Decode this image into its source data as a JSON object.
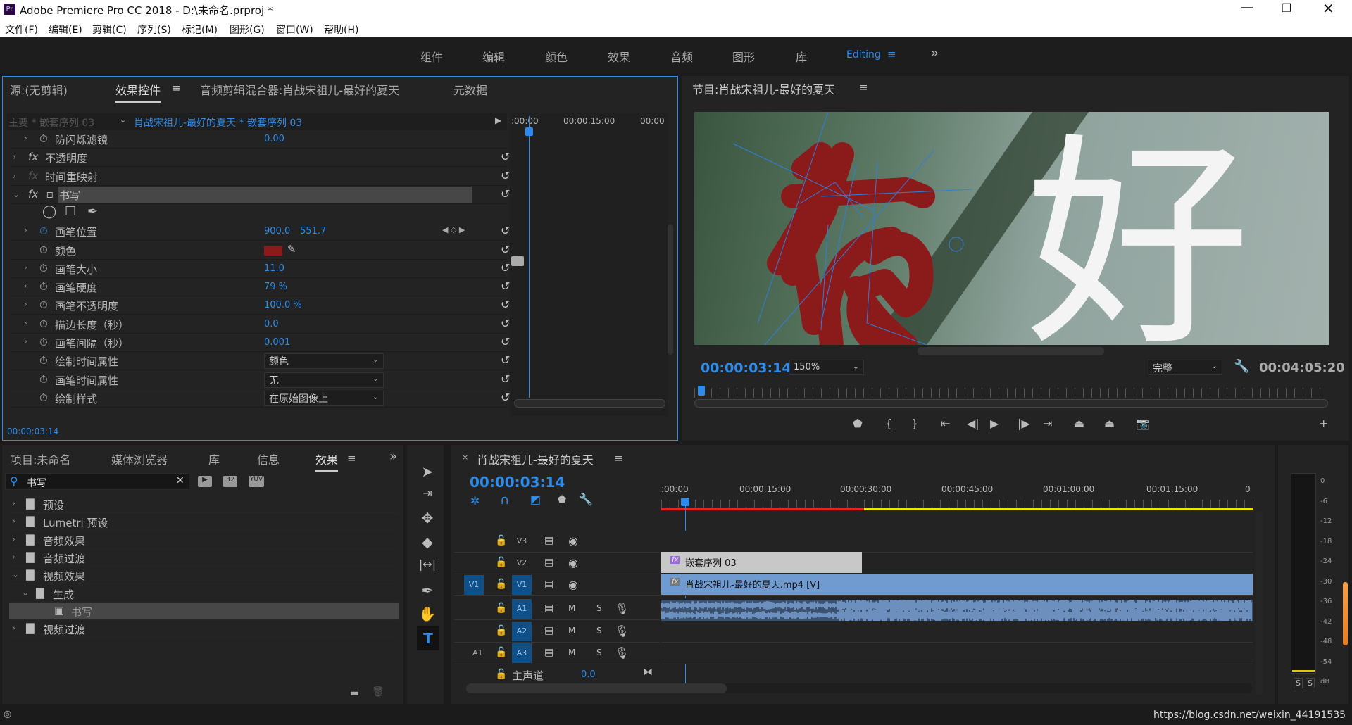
{
  "app": {
    "title": "Adobe Premiere Pro CC 2018 - D:\\未命名.prproj *",
    "logo": "Pr"
  },
  "menu": [
    "文件(F)",
    "编辑(E)",
    "剪辑(C)",
    "序列(S)",
    "标记(M)",
    "图形(G)",
    "窗口(W)",
    "帮助(H)"
  ],
  "workspaces": [
    "组件",
    "编辑",
    "颜色",
    "效果",
    "音频",
    "图形",
    "库",
    "Editing"
  ],
  "workspace_active": "Editing",
  "source_panel": {
    "tabs": [
      "源:(无剪辑)",
      "效果控件",
      "音频剪辑混合器:肖战宋祖儿-最好的夏天",
      "元数据"
    ],
    "active_tab": "效果控件",
    "master": "主要 * 嵌套序列 03",
    "clip": "肖战宋祖儿-最好的夏天 * 嵌套序列 03",
    "ruler": [
      ":00:00",
      "00:00:15:00",
      "00:00"
    ],
    "rows": [
      {
        "label": "防闪烁滤镜",
        "value": "0.00"
      },
      {
        "label": "不透明度",
        "fx": true
      },
      {
        "label": "时间重映射",
        "fx": true
      },
      {
        "label": "书写",
        "fx": true,
        "selected": true
      },
      {
        "label": "画笔位置",
        "value": "900.0",
        "value2": "551.7"
      },
      {
        "label": "颜色",
        "color": "#8b1a1a"
      },
      {
        "label": "画笔大小",
        "value": "11.0"
      },
      {
        "label": "画笔硬度",
        "value": "79 %"
      },
      {
        "label": "画笔不透明度",
        "value": "100.0 %"
      },
      {
        "label": "描边长度（秒）",
        "value": "0.0"
      },
      {
        "label": "画笔间隔（秒）",
        "value": "0.001"
      },
      {
        "label": "绘制时间属性",
        "dropdown": "颜色"
      },
      {
        "label": "画笔时间属性",
        "dropdown": "无"
      },
      {
        "label": "绘制样式",
        "dropdown": "在原始图像上"
      }
    ],
    "timecode": "00:00:03:14"
  },
  "program": {
    "title": "节目:肖战宋祖儿-最好的夏天",
    "overlay_char": "好",
    "timecode": "00:00:03:14",
    "zoom": "150%",
    "quality": "完整",
    "duration": "00:04:05:20"
  },
  "project_panel": {
    "tabs": [
      "项目:未命名",
      "媒体浏览器",
      "库",
      "信息",
      "效果"
    ],
    "active_tab": "效果",
    "search": "书写",
    "badges": [
      "32",
      "YUV"
    ],
    "tree": [
      {
        "label": "预设",
        "level": 0,
        "expanded": false
      },
      {
        "label": "Lumetri 预设",
        "level": 0,
        "expanded": false
      },
      {
        "label": "音频效果",
        "level": 0,
        "expanded": false
      },
      {
        "label": "音频过渡",
        "level": 0,
        "expanded": false
      },
      {
        "label": "视频效果",
        "level": 0,
        "expanded": true
      },
      {
        "label": "生成",
        "level": 1,
        "expanded": true
      },
      {
        "label": "书写",
        "level": 2,
        "selected": true
      },
      {
        "label": "视频过渡",
        "level": 0,
        "expanded": false
      }
    ]
  },
  "timeline": {
    "title": "肖战宋祖儿-最好的夏天",
    "timecode": "00:00:03:14",
    "ruler": [
      ":00:00",
      "00:00:15:00",
      "00:00:30:00",
      "00:00:45:00",
      "00:01:00:00",
      "00:01:15:00",
      "0"
    ],
    "tracks": {
      "v3": "V3",
      "v2": "V2",
      "v1": "V1",
      "a1": "A1",
      "a2": "A2",
      "a3": "A3",
      "src_v": "V1",
      "src_a": "A1",
      "m": "M",
      "s": "S"
    },
    "clip_v2": "嵌套序列 03",
    "clip_v1": "肖战宋祖儿-最好的夏天.mp4 [V]",
    "master_label": "主声道",
    "master_value": "0.0"
  },
  "meters": {
    "labels": [
      "0",
      "-6",
      "-12",
      "-18",
      "-24",
      "-30",
      "-36",
      "-42",
      "-48",
      "-54",
      "dB"
    ],
    "solo": [
      "S",
      "S"
    ]
  },
  "status": {
    "url": "https://blog.csdn.net/weixin_44191535"
  },
  "colors": {
    "accent": "#2d8ceb",
    "stroke": "#8b1a1a",
    "clip_v2": "#c8c8c8",
    "clip_v1": "#6f9bd1",
    "work_red": "#e8231c",
    "work_yellow": "#f2e600"
  }
}
